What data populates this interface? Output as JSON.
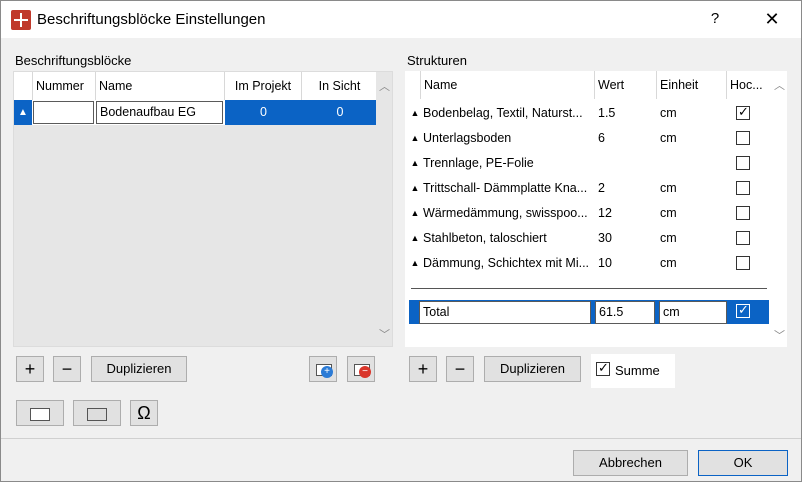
{
  "window": {
    "title": "Beschriftungsblöcke Einstellungen",
    "help": "?",
    "close": "✕"
  },
  "left": {
    "label": "Beschriftungsblöcke",
    "columns": [
      "Nummer",
      "Name",
      "Im Projekt",
      "In Sicht"
    ],
    "rows": [
      {
        "nummer": "",
        "name": "Bodenaufbau EG",
        "im_projekt": "0",
        "in_sicht": "0"
      }
    ],
    "buttons": {
      "add": "+",
      "remove": "−",
      "duplicate": "Duplizieren"
    }
  },
  "right": {
    "label": "Strukturen",
    "columns": [
      "Name",
      "Wert",
      "Einheit",
      "Hoc..."
    ],
    "rows": [
      {
        "name": "Bodenbelag, Textil, Naturst...",
        "wert": "1.5",
        "einheit": "cm",
        "checked": true
      },
      {
        "name": "Unterlagsboden",
        "wert": "6",
        "einheit": "cm",
        "checked": false
      },
      {
        "name": "Trennlage, PE-Folie",
        "wert": "",
        "einheit": "",
        "checked": false
      },
      {
        "name": "Trittschall- Dämmplatte Kna...",
        "wert": "2",
        "einheit": "cm",
        "checked": false
      },
      {
        "name": "Wärmedämmung, swisspoo...",
        "wert": "12",
        "einheit": "cm",
        "checked": false
      },
      {
        "name": "Stahlbeton, taloschiert",
        "wert": "30",
        "einheit": "cm",
        "checked": false
      },
      {
        "name": "Dämmung, Schichtex mit Mi...",
        "wert": "10",
        "einheit": "cm",
        "checked": false
      }
    ],
    "total": {
      "name": "Total",
      "wert": "61.5",
      "einheit": "cm",
      "checked": true
    },
    "buttons": {
      "add": "+",
      "remove": "−",
      "duplicate": "Duplizieren"
    },
    "summe": {
      "label": "Summe",
      "checked": true
    }
  },
  "bottom": {
    "cancel": "Abbrechen",
    "ok": "OK",
    "omega": "Ω"
  },
  "colors": {
    "selection": "#0b63c5",
    "accent_red": "#c0392b"
  }
}
